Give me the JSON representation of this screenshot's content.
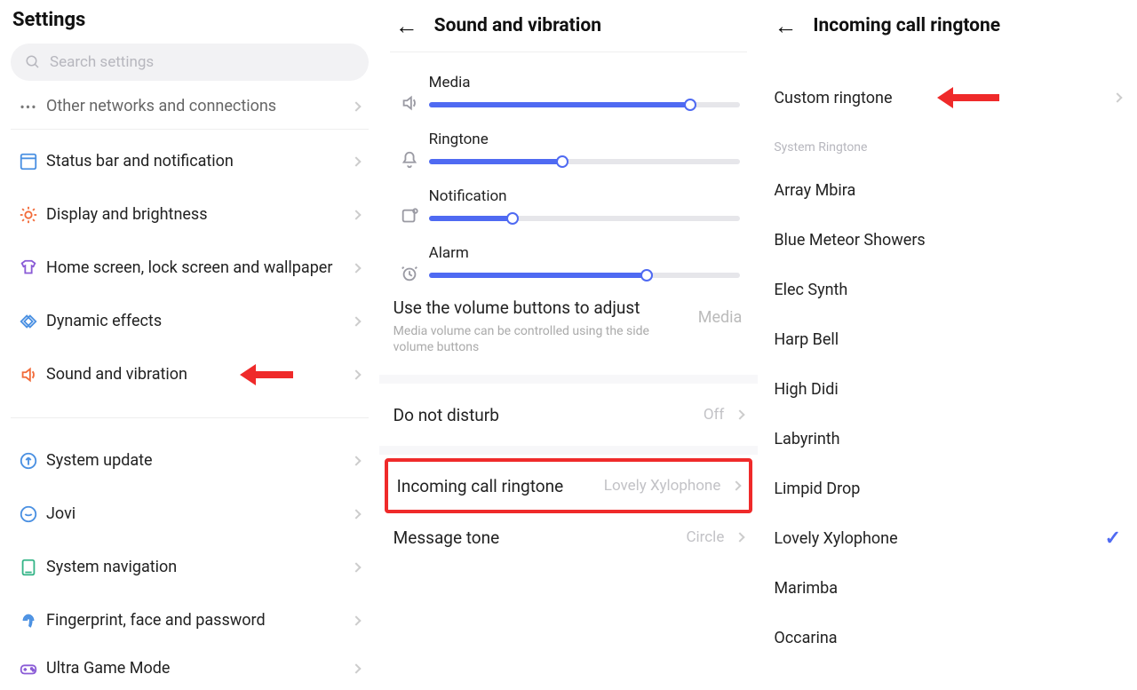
{
  "panel1": {
    "title": "Settings",
    "search_placeholder": "Search settings",
    "truncated_label": "Other networks and connections",
    "items": [
      {
        "label": "Status bar and notification"
      },
      {
        "label": "Display and brightness"
      },
      {
        "label": "Home screen, lock screen and wallpaper"
      },
      {
        "label": "Dynamic effects"
      },
      {
        "label": "Sound and vibration"
      }
    ],
    "items2": [
      {
        "label": "System update"
      },
      {
        "label": "Jovi"
      },
      {
        "label": "System navigation"
      },
      {
        "label": "Fingerprint, face and password"
      },
      {
        "label": "Ultra Game Mode"
      }
    ]
  },
  "panel2": {
    "title": "Sound and vibration",
    "sliders": [
      {
        "label": "Media",
        "percent": 84
      },
      {
        "label": "Ringtone",
        "percent": 43
      },
      {
        "label": "Notification",
        "percent": 27
      },
      {
        "label": "Alarm",
        "percent": 70
      }
    ],
    "volbtn_title": "Use the volume buttons to adjust",
    "volbtn_sub": "Media volume can be controlled using the side volume buttons",
    "volbtn_value": "Media",
    "dnd_label": "Do not disturb",
    "dnd_value": "Off",
    "ringtone_label": "Incoming call ringtone",
    "ringtone_value": "Lovely Xylophone",
    "msg_label": "Message tone",
    "msg_value": "Circle"
  },
  "panel3": {
    "title": "Incoming call ringtone",
    "custom_label": "Custom ringtone",
    "section": "System Ringtone",
    "ringtones": [
      {
        "label": "Array Mbira",
        "selected": false
      },
      {
        "label": "Blue Meteor Showers",
        "selected": false
      },
      {
        "label": "Elec Synth",
        "selected": false
      },
      {
        "label": "Harp Bell",
        "selected": false
      },
      {
        "label": "High Didi",
        "selected": false
      },
      {
        "label": "Labyrinth",
        "selected": false
      },
      {
        "label": "Limpid Drop",
        "selected": false
      },
      {
        "label": "Lovely Xylophone",
        "selected": true
      },
      {
        "label": "Marimba",
        "selected": false
      },
      {
        "label": "Occarina",
        "selected": false
      }
    ]
  }
}
